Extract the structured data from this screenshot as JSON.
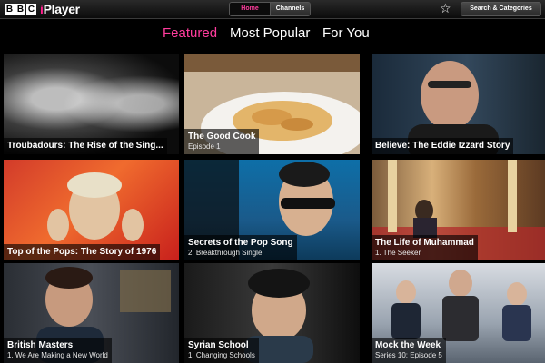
{
  "header": {
    "logo_bbc": [
      "B",
      "B",
      "C"
    ],
    "logo_i": "i",
    "logo_player": "Player",
    "nav": {
      "home": "Home",
      "channels": "Channels"
    },
    "favourites_icon": "star-icon",
    "search_label": "Search & Categories"
  },
  "tabs": [
    {
      "label": "Featured",
      "active": true
    },
    {
      "label": "Most Popular",
      "active": false
    },
    {
      "label": "For You",
      "active": false
    }
  ],
  "programmes": [
    {
      "title": "Troubadours: The Rise of the Sing...",
      "subtitle": ""
    },
    {
      "title": "The Good Cook",
      "subtitle": "Episode 1"
    },
    {
      "title": "Believe: The Eddie Izzard Story",
      "subtitle": ""
    },
    {
      "title": "Top of the Pops: The Story of 1976",
      "subtitle": ""
    },
    {
      "title": "Secrets of the Pop Song",
      "subtitle": "2. Breakthrough Single"
    },
    {
      "title": "The Life of Muhammad",
      "subtitle": "1. The Seeker"
    },
    {
      "title": "British Masters",
      "subtitle": "1. We Are Making a New World"
    },
    {
      "title": "Syrian School",
      "subtitle": "1. Changing Schools"
    },
    {
      "title": "Mock the Week",
      "subtitle": "Series 10: Episode 5"
    }
  ],
  "colors": {
    "accent_pink": "#ff3c9d",
    "bar": "#1a1a1a"
  }
}
